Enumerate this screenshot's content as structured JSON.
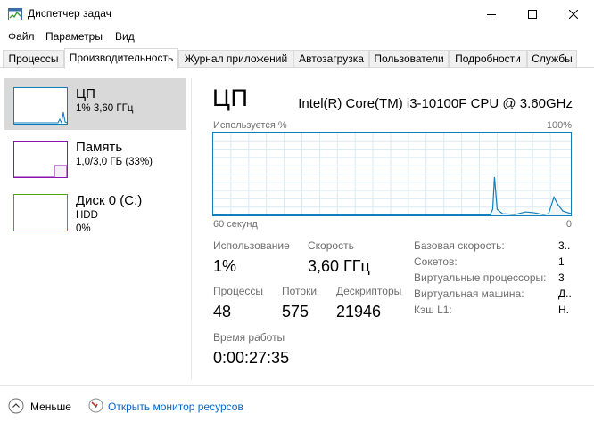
{
  "window": {
    "title": "Диспетчер задач"
  },
  "menu": [
    "Файл",
    "Параметры",
    "Вид"
  ],
  "tabs": [
    "Процессы",
    "Производительность",
    "Журнал приложений",
    "Автозагрузка",
    "Пользователи",
    "Подробности",
    "Службы"
  ],
  "active_tab": "Производительность",
  "resources": [
    {
      "title": "ЦП",
      "line1": "1% 3,60 ГГц",
      "color": "#117dbb"
    },
    {
      "title": "Память",
      "line1": "1,0/3,0 ГБ (33%)",
      "color": "#8b12ae"
    },
    {
      "title": "Диск 0 (C:)",
      "line1": "HDD",
      "line2": "0%",
      "color": "#4da60c"
    }
  ],
  "main": {
    "title": "ЦП",
    "cpu_model": "Intel(R) Core(TM) i3-10100F CPU @ 3.60GHz",
    "graph_top_left": "Используется %",
    "graph_top_right": "100%",
    "graph_bottom_left": "60 секунд",
    "graph_bottom_right": "0",
    "stats": {
      "usage_label": "Использование",
      "usage_value": "1%",
      "speed_label": "Скорость",
      "speed_value": "3,60 ГГц",
      "processes_label": "Процессы",
      "processes_value": "48",
      "threads_label": "Потоки",
      "threads_value": "575",
      "handles_label": "Дескрипторы",
      "handles_value": "21946",
      "uptime_label": "Время работы",
      "uptime_value": "0:00:27:35"
    },
    "info": [
      {
        "label": "Базовая скорость:",
        "value": "3.."
      },
      {
        "label": "Сокетов:",
        "value": "1"
      },
      {
        "label": "Виртуальные процессоры:",
        "value": "3"
      },
      {
        "label": "Виртуальная машина:",
        "value": "Д.."
      },
      {
        "label": "Кэш L1:",
        "value": "Н."
      }
    ]
  },
  "footer": {
    "less_label": "Меньше",
    "monitor_link": "Открыть монитор ресурсов"
  },
  "colors": {
    "cpu_line": "#117dbb",
    "cpu_fill": "#f1f6fa",
    "grid": "#d9eaf4",
    "link": "#0066cc",
    "selected_bg": "#d9d9d9"
  }
}
